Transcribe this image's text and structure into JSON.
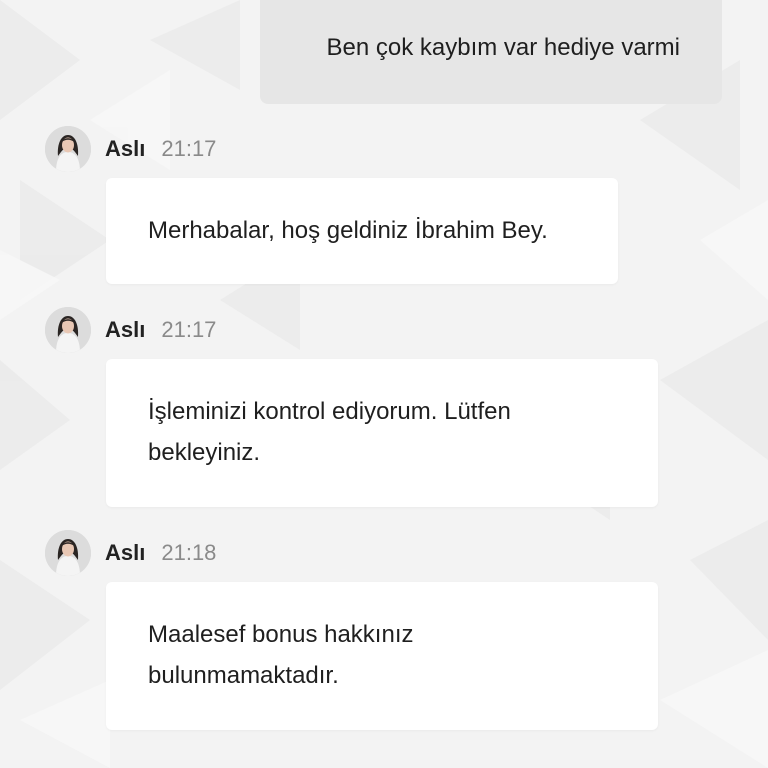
{
  "messages": [
    {
      "type": "user",
      "text": "Ben çok kaybım var hediye varmi"
    },
    {
      "type": "agent",
      "name": "Aslı",
      "time": "21:17",
      "lines": [
        "Merhabalar, hoş geldiniz İbrahim Bey."
      ]
    },
    {
      "type": "agent",
      "name": "Aslı",
      "time": "21:17",
      "lines": [
        "İşleminizi kontrol ediyorum. Lütfen",
        "bekleyiniz."
      ]
    },
    {
      "type": "agent",
      "name": "Aslı",
      "time": "21:18",
      "lines": [
        "Maalesef bonus hakkınız",
        "bulunmamaktadır."
      ]
    }
  ],
  "colors": {
    "background": "#f3f3f3",
    "user_bubble": "#e6e6e6",
    "agent_bubble": "#ffffff",
    "time_text": "#8a8a8a"
  },
  "icons": {
    "avatar": "agent-avatar-icon"
  }
}
